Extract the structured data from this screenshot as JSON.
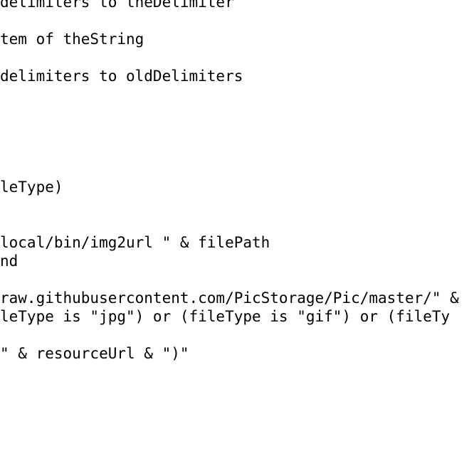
{
  "editor": {
    "lines": [
      "delimiters to theDelimiter",
      "tem of theString",
      "delimiters to oldDelimiters",
      "leType)",
      "local/bin/img2url \" & filePath",
      "nd",
      "raw.githubusercontent.com/PicStorage/Pic/master/\" &",
      "leType is \"jpg\") or (fileType is \"gif\") or (fileTy",
      "\" & resourceUrl & \")\""
    ]
  }
}
